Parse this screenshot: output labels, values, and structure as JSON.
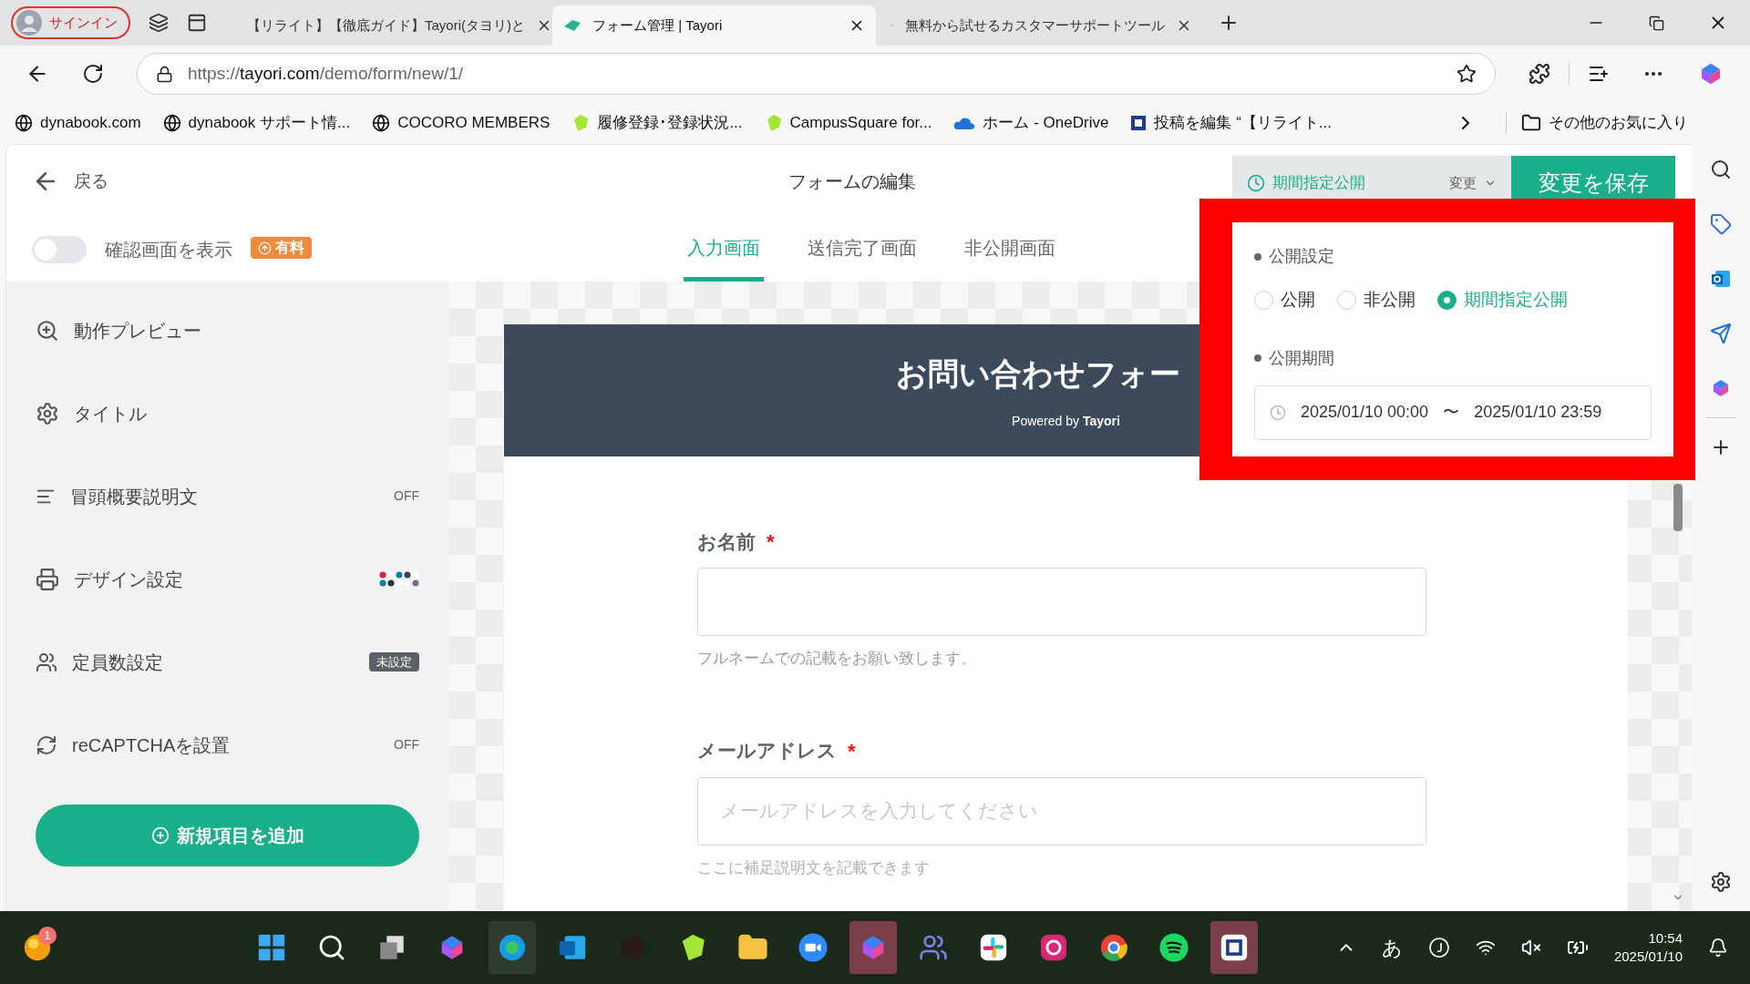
{
  "browser": {
    "profile": "サインイン",
    "tabs": [
      {
        "title": "【リライト】【徹底ガイド】Tayori(タヨリ)と",
        "selected": false
      },
      {
        "title": "フォーム管理 | Tayori",
        "selected": true
      },
      {
        "title": "無料から試せるカスタマーサポートツール",
        "selected": false
      }
    ],
    "url_scheme": "https://",
    "url_host": "tayori.com",
    "url_path": "/demo/form/new/1/",
    "bookmarks": [
      "dynabook.com",
      "dynabook サポート情...",
      "COCORO MEMBERS",
      "履修登録･登録状況...",
      "CampusSquare for...",
      "ホーム - OneDrive",
      "投稿を編集 “【リライト..."
    ],
    "other_bookmarks": "その他のお気に入り"
  },
  "header": {
    "back": "戻る",
    "title": "フォームの編集",
    "status": "期間指定公開",
    "change": "変更",
    "save": "変更を保存"
  },
  "confirm_toggle": {
    "label": "確認画面を表示",
    "on": false,
    "paid_badge": "有料"
  },
  "screen_tabs": [
    {
      "label": "入力画面",
      "selected": true
    },
    {
      "label": "送信完了画面",
      "selected": false
    },
    {
      "label": "非公開画面",
      "selected": false
    }
  ],
  "sidebar": {
    "items": [
      {
        "label": "動作プレビュー",
        "kind": "plain"
      },
      {
        "label": "タイトル",
        "kind": "plain"
      },
      {
        "label": "冒頭概要説明文",
        "kind": "text",
        "badge": "OFF"
      },
      {
        "label": "デザイン設定",
        "kind": "dots"
      },
      {
        "label": "定員数設定",
        "kind": "tag",
        "badge": "未設定"
      },
      {
        "label": "reCAPTCHAを設置",
        "kind": "text",
        "badge": "OFF"
      }
    ],
    "add_button": "新規項目を追加"
  },
  "form": {
    "title": "お問い合わせフォー",
    "powered_by": "Powered by",
    "brand": "Tayori",
    "fields": [
      {
        "label": "お名前",
        "required_mark": "*",
        "help": "フルネームでの記載をお願い致します。"
      },
      {
        "label": "メールアドレス",
        "required_mark": "*",
        "placeholder": "メールアドレスを入力してください",
        "help": "ここに補足説明文を記載できます"
      }
    ]
  },
  "popup": {
    "visibility_heading": "公開設定",
    "options": [
      {
        "label": "公開",
        "selected": false
      },
      {
        "label": "非公開",
        "selected": false
      },
      {
        "label": "期間指定公開",
        "selected": true
      }
    ],
    "period_heading": "公開期間",
    "start": "2025/01/10 00:00",
    "separator": "〜",
    "end": "2025/01/10 23:59"
  },
  "taskbar": {
    "notification_count": "1",
    "ime": "あ",
    "time": "10:54",
    "date": "2025/01/10"
  }
}
